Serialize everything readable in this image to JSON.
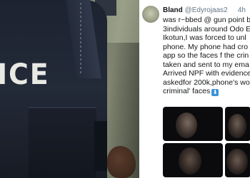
{
  "photo": {
    "vest_text": "ICE"
  },
  "tweet": {
    "name": "Bland",
    "handle": "@Edyrojaas2",
    "time": "4h",
    "lines": [
      "was r~bbed @ gun point b",
      "3individuals around Odo E",
      "Ikotun,I was forced to unl",
      "phone. My phone had cro",
      "app so the faces f the crin",
      "taken and sent to my ema",
      "Arrived NPF with evidence",
      "askedfor 200k,phone's wo",
      "criminal' faces"
    ],
    "arrow_icon": "down-arrow-emoji",
    "accent": "#3b94d9"
  }
}
